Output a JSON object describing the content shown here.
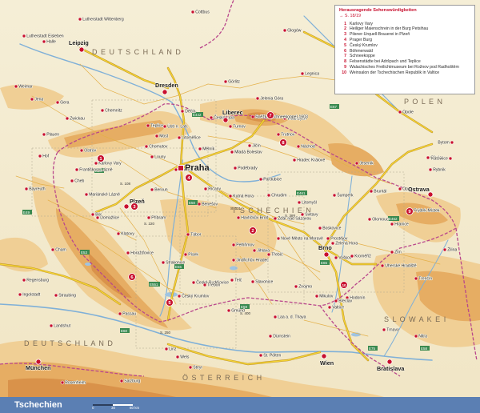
{
  "legend": {
    "title": "Herausragende Sehenswürdigkeiten",
    "ref": "→ S. 18/19",
    "items": [
      {
        "num": "1",
        "label": "Karlovy Vary"
      },
      {
        "num": "2",
        "label": "Heiliger Maienschrein in der Burg Petsihau"
      },
      {
        "num": "3",
        "label": "Pilsner-Urquell-Brauerei in Plzeň"
      },
      {
        "num": "4",
        "label": "Prager Burg"
      },
      {
        "num": "5",
        "label": "Český Krumlov"
      },
      {
        "num": "6",
        "label": "Böhmerwald"
      },
      {
        "num": "7",
        "label": "Schneekoppe"
      },
      {
        "num": "8",
        "label": "Felsenstädte bei Adršpach und Teplice"
      },
      {
        "num": "9",
        "label": "Walachisches Freilichtmuseum bei Rožnov pod Radhoštěm"
      },
      {
        "num": "10",
        "label": "Weinsalon der Tschechischen Republik in Valtice"
      }
    ]
  },
  "footer": {
    "title": "Tschechien",
    "scale_labels": [
      "0",
      "30",
      "60 km"
    ]
  },
  "country_labels": [
    {
      "text": "D E U T S C H L A N D"
    },
    {
      "text": "P O L E N"
    },
    {
      "text": "T S C H E C H I E N"
    },
    {
      "text": "S L O W A K E I"
    },
    {
      "text": "Ö S T E R R E I C H"
    },
    {
      "text": "D E U T S C H L A N D"
    }
  ],
  "capital": {
    "name": "Praha"
  },
  "major_cities": [
    {
      "name": "Ostrava"
    },
    {
      "name": "Brno"
    },
    {
      "name": "Plzeň"
    },
    {
      "name": "Liberec"
    },
    {
      "name": "Wrocław"
    },
    {
      "name": "Wien"
    },
    {
      "name": "München"
    },
    {
      "name": "Dresden"
    },
    {
      "name": "Leipzig"
    },
    {
      "name": "Bratislava"
    }
  ],
  "cities": [
    {
      "name": "Cottbus"
    },
    {
      "name": "Lutherstadt Wittenberg"
    },
    {
      "name": "Lutherstadt Eisleben"
    },
    {
      "name": "Halle"
    },
    {
      "name": "Glogów"
    },
    {
      "name": "Legnica"
    },
    {
      "name": "Weimar"
    },
    {
      "name": "Jena"
    },
    {
      "name": "Gera"
    },
    {
      "name": "Chemnitz"
    },
    {
      "name": "Zwickau"
    },
    {
      "name": "Plauen"
    },
    {
      "name": "Hof"
    },
    {
      "name": "Bayreuth"
    },
    {
      "name": "Görlitz"
    },
    {
      "name": "Jelenia Góra"
    },
    {
      "name": "Wałbrzych"
    },
    {
      "name": "Opole"
    },
    {
      "name": "Bytom"
    },
    {
      "name": "Gliwice"
    },
    {
      "name": "Katowice"
    },
    {
      "name": "Rybnik"
    },
    {
      "name": "Děčín"
    },
    {
      "name": "Česká Lípa"
    },
    {
      "name": "Teplice"
    },
    {
      "name": "Ústí n. Lab."
    },
    {
      "name": "Most"
    },
    {
      "name": "Litoměřice"
    },
    {
      "name": "Chomutov"
    },
    {
      "name": "Ostrov"
    },
    {
      "name": "Karlovy Vary"
    },
    {
      "name": "Cheb"
    },
    {
      "name": "Františkovy Lázně"
    },
    {
      "name": "Mariánské Lázně"
    },
    {
      "name": "Mělník"
    },
    {
      "name": "Mladá Boleslav"
    },
    {
      "name": "Jičín"
    },
    {
      "name": "Turnov"
    },
    {
      "name": "Trutnov"
    },
    {
      "name": "Sněžka (Schneekoppe) 1603"
    },
    {
      "name": "Náchod"
    },
    {
      "name": "Hradec Králové"
    },
    {
      "name": "Pardubice"
    },
    {
      "name": "Chrudim"
    },
    {
      "name": "Litomyšl"
    },
    {
      "name": "Jeseník"
    },
    {
      "name": "Bruntál"
    },
    {
      "name": "Opava"
    },
    {
      "name": "Šumperk"
    },
    {
      "name": "Olomouc"
    },
    {
      "name": "Frýdek-Místek"
    },
    {
      "name": "Louny"
    },
    {
      "name": "Kladno"
    },
    {
      "name": "Beroun"
    },
    {
      "name": "Říčany"
    },
    {
      "name": "Poděbrady"
    },
    {
      "name": "Kutná Hora"
    },
    {
      "name": "Benešov"
    },
    {
      "name": "Havlíčkův Brod"
    },
    {
      "name": "Žďár nad Sázavou"
    },
    {
      "name": "Svitavy"
    },
    {
      "name": "Nové Město na Moravě"
    },
    {
      "name": "Boskovice"
    },
    {
      "name": "Prostějov"
    },
    {
      "name": "Zlín"
    },
    {
      "name": "Hranice"
    },
    {
      "name": "Žilina"
    },
    {
      "name": "Zelená Hora"
    },
    {
      "name": "Vyškov"
    },
    {
      "name": "Kroměříž"
    },
    {
      "name": "Uherské Hradiště"
    },
    {
      "name": "Trenčín"
    },
    {
      "name": "Příbram"
    },
    {
      "name": "Tábor"
    },
    {
      "name": "Pelhřimov"
    },
    {
      "name": "Jihlava"
    },
    {
      "name": "Třebíč"
    },
    {
      "name": "Jindřichův Hradec"
    },
    {
      "name": "Telč"
    },
    {
      "name": "Písek"
    },
    {
      "name": "Strakonice"
    },
    {
      "name": "Klatovy"
    },
    {
      "name": "Domažlice"
    },
    {
      "name": "Horažďovice"
    },
    {
      "name": "Bor"
    },
    {
      "name": "Cham"
    },
    {
      "name": "Regensburg"
    },
    {
      "name": "Straubing"
    },
    {
      "name": "Ingolstadt"
    },
    {
      "name": "Landshut"
    },
    {
      "name": "Passau"
    },
    {
      "name": "České Budějovice"
    },
    {
      "name": "Český Krumlov"
    },
    {
      "name": "Třeboň"
    },
    {
      "name": "Slavonice"
    },
    {
      "name": "Znojmo"
    },
    {
      "name": "Mikulov"
    },
    {
      "name": "Hodonín"
    },
    {
      "name": "Břeclav"
    },
    {
      "name": "Valtice"
    },
    {
      "name": "Gmünd"
    },
    {
      "name": "Laa a. d. Thaya"
    },
    {
      "name": "Linz"
    },
    {
      "name": "Wels"
    },
    {
      "name": "Steyr"
    },
    {
      "name": "Salzburg"
    },
    {
      "name": "Rosenheim"
    },
    {
      "name": "St. Pölten"
    },
    {
      "name": "Dürnstein"
    },
    {
      "name": "Trnava"
    },
    {
      "name": "Nitra"
    }
  ],
  "sight_markers": [
    "1",
    "2",
    "3",
    "4",
    "5",
    "6",
    "7",
    "8",
    "9",
    "10"
  ],
  "highway_labels": [
    "E49",
    "E50",
    "E48",
    "E53",
    "E55",
    "E65",
    "E442",
    "E59",
    "E60",
    "E461",
    "E462",
    "E67",
    "E40",
    "E75",
    "E58",
    "E551"
  ],
  "route_labels": [
    "S. 108",
    "S. 220",
    "S. 250",
    "S. 331",
    "S. 400",
    "S. 388"
  ],
  "colors": {
    "lowland": "#f4ecd2",
    "hills": "#f0cf95",
    "mountain": "#e6ad63",
    "high_mountain": "#d9924a",
    "water": "#7fb0d8",
    "border": "#b9478c",
    "highway": "#f3d335",
    "highway_casing": "#b8871c",
    "road": "#e4b04a",
    "city_red": "#c8102e",
    "footer": "#5b7fb3"
  }
}
